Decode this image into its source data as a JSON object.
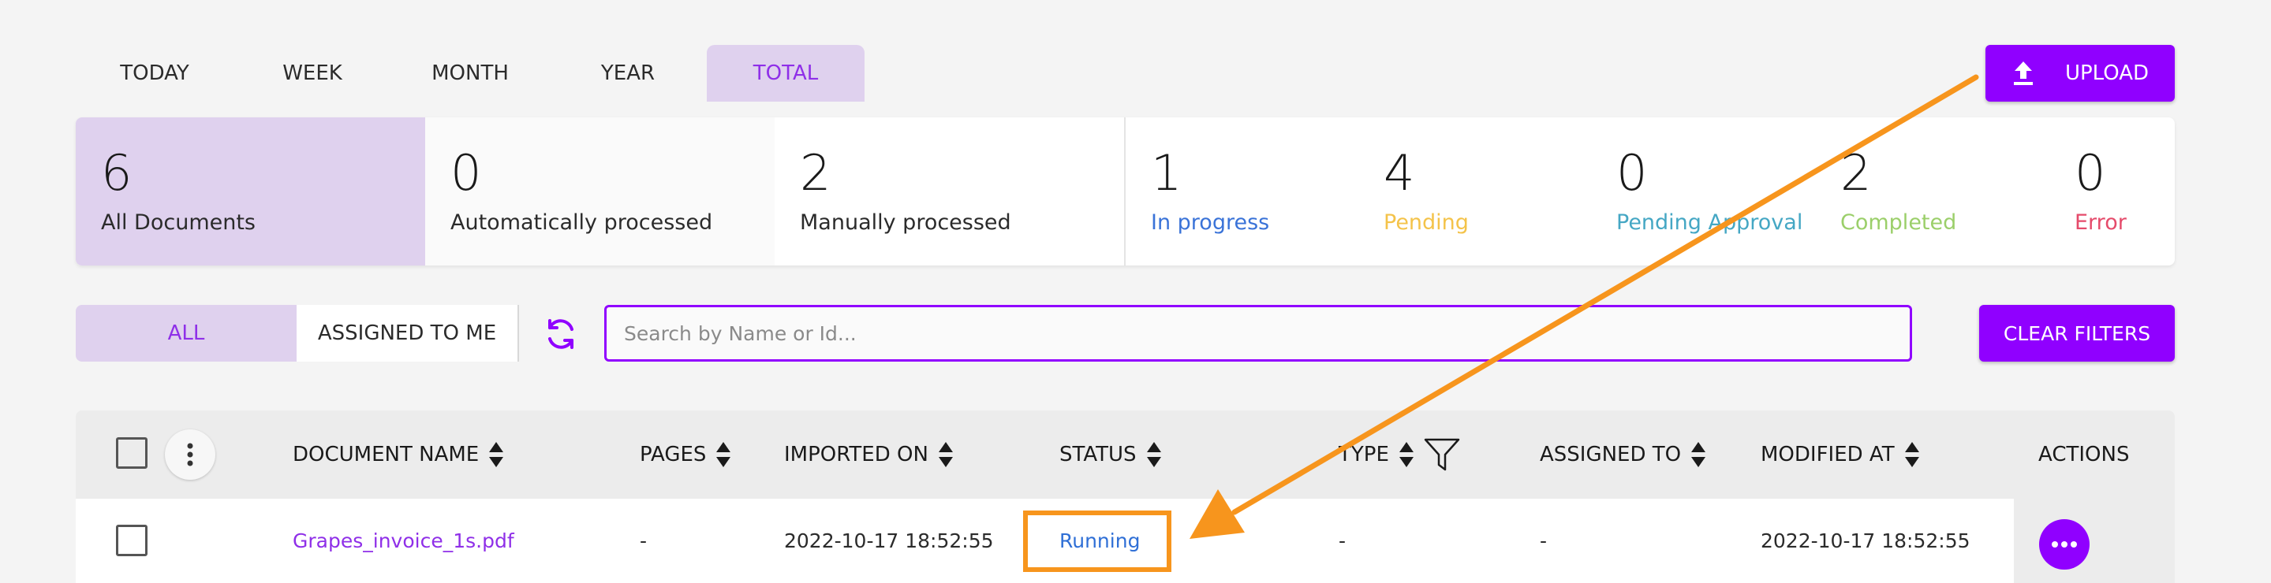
{
  "colors": {
    "accent": "#9000ff",
    "accent_light": "#dfd1ee",
    "annotation": "#f7951d"
  },
  "period_tabs": [
    {
      "label": "TODAY",
      "active": false
    },
    {
      "label": "WEEK",
      "active": false
    },
    {
      "label": "MONTH",
      "active": false
    },
    {
      "label": "YEAR",
      "active": false
    },
    {
      "label": "TOTAL",
      "active": true
    }
  ],
  "upload": {
    "label": "UPLOAD",
    "icon": "upload-icon"
  },
  "stats": [
    {
      "value": "6",
      "label": "All Documents",
      "color": "#2b2b2b"
    },
    {
      "value": "0",
      "label": "Automatically processed",
      "color": "#2b2b2b"
    },
    {
      "value": "2",
      "label": "Manually processed",
      "color": "#2b2b2b"
    },
    {
      "value": "1",
      "label": "In progress",
      "color": "#3a73d8"
    },
    {
      "value": "4",
      "label": "Pending",
      "color": "#f4c34a"
    },
    {
      "value": "0",
      "label": "Pending Approval",
      "color": "#45a7c4"
    },
    {
      "value": "2",
      "label": "Completed",
      "color": "#9bcf6a"
    },
    {
      "value": "0",
      "label": "Error",
      "color": "#e54b6b"
    }
  ],
  "filters": {
    "all_label": "ALL",
    "assigned_label": "ASSIGNED TO ME",
    "search_placeholder": "Search by Name or Id...",
    "clear_label": "CLEAR FILTERS"
  },
  "table": {
    "columns": {
      "name": "DOCUMENT NAME",
      "pages": "PAGES",
      "imported": "IMPORTED ON",
      "status": "STATUS",
      "type": "TYPE",
      "assigned": "ASSIGNED TO",
      "modified": "MODIFIED AT",
      "actions": "ACTIONS"
    },
    "rows": [
      {
        "name": "Grapes_invoice_1s.pdf",
        "pages": "-",
        "imported": "2022-10-17 18:52:55",
        "status": "Running",
        "type": "-",
        "assigned": "-",
        "modified": "2022-10-17 18:52:55"
      }
    ]
  }
}
